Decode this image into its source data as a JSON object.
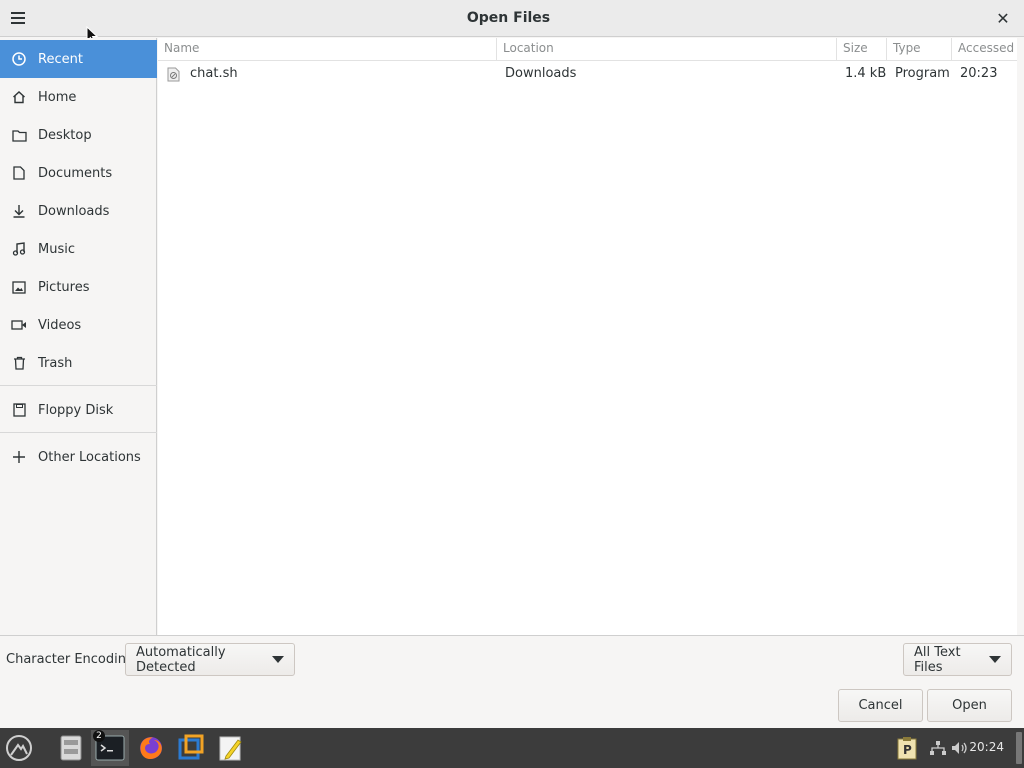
{
  "window": {
    "title": "Open Files"
  },
  "sidebar": {
    "items": [
      {
        "label": "Recent",
        "icon": "clock-icon"
      },
      {
        "label": "Home",
        "icon": "home-icon"
      },
      {
        "label": "Desktop",
        "icon": "folder-icon"
      },
      {
        "label": "Documents",
        "icon": "document-icon"
      },
      {
        "label": "Downloads",
        "icon": "download-icon"
      },
      {
        "label": "Music",
        "icon": "music-icon"
      },
      {
        "label": "Pictures",
        "icon": "picture-icon"
      },
      {
        "label": "Videos",
        "icon": "video-icon"
      },
      {
        "label": "Trash",
        "icon": "trash-icon"
      },
      {
        "label": "Floppy Disk",
        "icon": "floppy-icon"
      },
      {
        "label": "Other Locations",
        "icon": "plus-icon"
      }
    ]
  },
  "file_list": {
    "columns": [
      "Name",
      "Location",
      "Size",
      "Type",
      "Accessed"
    ],
    "rows": [
      {
        "name": "chat.sh",
        "location": "Downloads",
        "size": "1.4 kB",
        "type": "Program",
        "accessed": "20:23"
      }
    ]
  },
  "footer": {
    "encoding_label": "Character Encoding:",
    "encoding_value": "Automatically Detected",
    "filter_value": "All Text Files",
    "cancel_label": "Cancel",
    "open_label": "Open"
  },
  "taskbar": {
    "terminal_badge": "2",
    "clock": "20:24"
  },
  "colors": {
    "accent": "#4a90d9",
    "taskbar": "#3c3c3c"
  }
}
